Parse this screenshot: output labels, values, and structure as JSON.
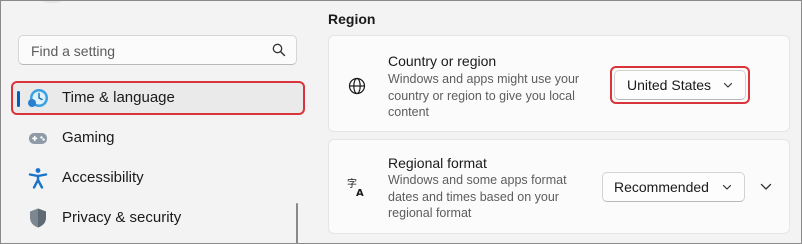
{
  "search": {
    "placeholder": "Find a setting",
    "icon": "search-icon"
  },
  "sidebar": {
    "items": [
      {
        "label": "Time & language",
        "icon": "time-language-icon",
        "active": true
      },
      {
        "label": "Gaming",
        "icon": "gamepad-icon"
      },
      {
        "label": "Accessibility",
        "icon": "accessibility-icon"
      },
      {
        "label": "Privacy & security",
        "icon": "shield-icon"
      }
    ]
  },
  "main": {
    "section_title": "Region",
    "cards": [
      {
        "title": "Country or region",
        "description": "Windows and apps might use your country or region to give you local content",
        "icon": "globe-icon",
        "dropdown_value": "United States"
      },
      {
        "title": "Regional format",
        "description": "Windows and some apps format dates and times based on your regional format",
        "icon": "language-format-icon",
        "dropdown_value": "Recommended"
      }
    ]
  },
  "colors": {
    "highlight": "#d9343b",
    "accent": "#005fb8"
  }
}
